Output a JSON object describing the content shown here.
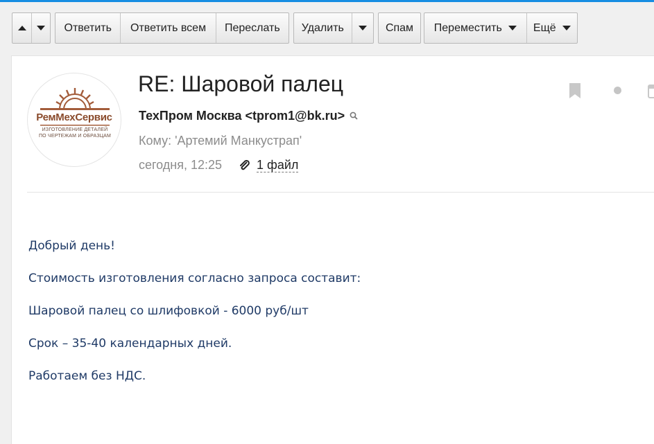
{
  "toolbar": {
    "reply": "Ответить",
    "reply_all": "Ответить всем",
    "forward": "Переслать",
    "delete": "Удалить",
    "spam": "Спам",
    "move": "Переместить",
    "more": "Ещё"
  },
  "logo": {
    "name": "РемМехСервис",
    "tagline_1": "ИЗГОТОВЛЕНИЕ ДЕТАЛЕЙ",
    "tagline_2": "ПО ЧЕРТЕЖАМ И ОБРАЗЦАМ"
  },
  "message": {
    "subject": "RE: Шаровой палец",
    "sender": "ТехПром Москва <tprom1@bk.ru>",
    "recipient": "Кому: 'Артемий Манкустрап'",
    "date": "сегодня, 12:25",
    "attachments_label": "1 файл",
    "body": [
      "Добрый день!",
      "Стоимость изготовления согласно запроса составит:",
      "Шаровой палец со шлифовкой - 6000 руб/шт",
      "Срок – 35-40 календарных дней.",
      "Работаем без НДС."
    ]
  },
  "colors": {
    "accent": "#168de2",
    "body_text": "#1f3a66",
    "muted": "#8c8c8c",
    "logo_brown": "#8a4b2c"
  }
}
